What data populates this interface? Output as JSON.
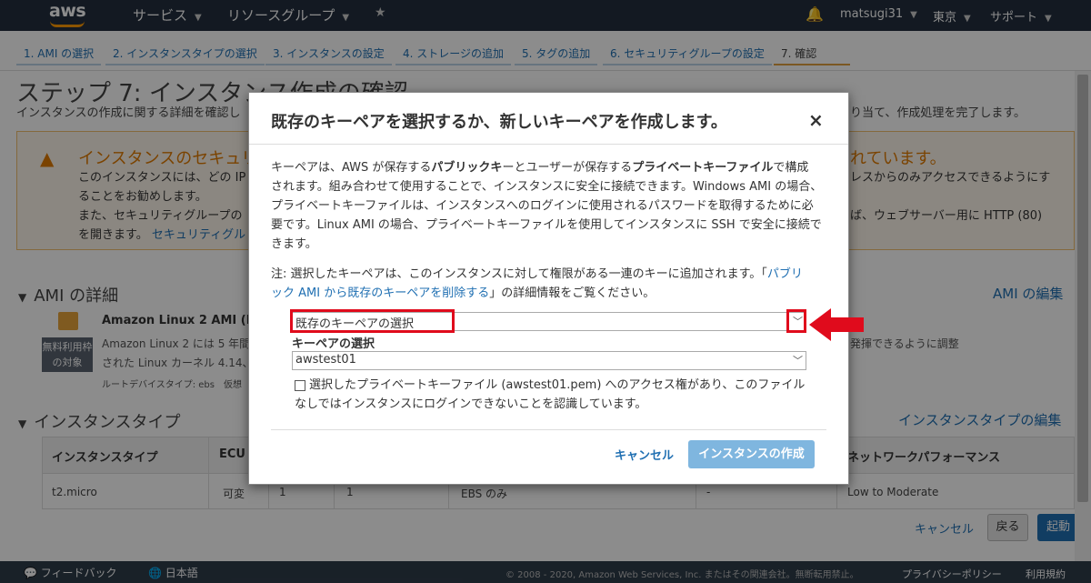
{
  "topnav": {
    "logo": "aws",
    "services": "サービス",
    "resource_groups": "リソースグループ",
    "user": "matsugi31",
    "region": "東京",
    "support": "サポート"
  },
  "tabs": [
    {
      "label": "1. AMI の選択"
    },
    {
      "label": "2. インスタンスタイプの選択"
    },
    {
      "label": "3. インスタンスの設定"
    },
    {
      "label": "4. ストレージの追加"
    },
    {
      "label": "5. タグの追加"
    },
    {
      "label": "6. セキュリティグループの設定"
    },
    {
      "label": "7. 確認"
    }
  ],
  "page": {
    "title": "ステップ 7: インスタンス作成の確認",
    "subtitle": "インスタンスの作成に関する詳細を確認し",
    "subtitle_right": "り当て、作成処理を完了します。",
    "warning_title": "インスタンスのセキュリ",
    "warning_title_right": "れています。",
    "warning_line1": "このインスタンスには、どの IP",
    "warning_line1_right": "レスからのみアクセスできるようにす",
    "warning_line2": "ることをお勧めします。",
    "warning_line3": "また、セキュリティグループの",
    "warning_line3_right": "ば、ウェブサーバー用に HTTP (80)",
    "warning_line4": "を開きます。",
    "warning_link": "セキュリティグル",
    "ami_section": "AMI の詳細",
    "ami_edit": "AMI の編集",
    "ami_name": "Amazon Linux 2 AMI (HV",
    "ami_badge_line1": "無料利用枠",
    "ami_badge_line2": "の対象",
    "ami_desc1": "Amazon Linux 2 には 5 年間の",
    "ami_desc1_right": "発揮できるように調整",
    "ami_desc2": "された Linux カーネル 4.14、",
    "ami_rootdev": "ルートデバイスタイプ: ebs　仮想",
    "instance_section": "インスタンスタイプ",
    "instance_edit": "インスタンスタイプの編集"
  },
  "table": {
    "headers": [
      "インスタンスタイプ",
      "ECU",
      "ネットワークパフォーマンス"
    ],
    "row": [
      "t2.micro",
      "可変",
      "1",
      "1",
      "EBS のみ",
      "-",
      "Low to Moderate"
    ]
  },
  "bottom_buttons": {
    "cancel": "キャンセル",
    "back": "戻る",
    "launch": "起動"
  },
  "footer": {
    "feedback": "フィードバック",
    "language": "日本語",
    "copyright": "© 2008 - 2020, Amazon Web Services, Inc. またはその関連会社。無断転用禁止。",
    "privacy": "プライバシーポリシー",
    "terms": "利用規約"
  },
  "modal": {
    "title": "既存のキーペアを選択するか、新しいキーペアを作成します。",
    "close": "×",
    "p1_l1_a": "キーペアは、AWS が保存する",
    "p1_l1_b": "パブリックキ",
    "p1_l1_c": "ーとユーザーが保存する",
    "p1_l1_d": "プライベートキーファイル",
    "p1_l1_e": "で構成",
    "p1_l2": "されます。組み合わせて使用することで、インスタンスに安全に接続できます。Windows AMI の場合、",
    "p1_l3": "プライベートキーファイルは、インスタンスへのログインに使用されるパスワードを取得するために必",
    "p1_l4": "要です。Linux AMI の場合、プライベートキーファイルを使用してインスタンスに SSH で安全に接続で",
    "p1_l5": "きます。",
    "note_l1_a": "注: 選択したキーペアは、このインスタンスに対して権限がある一連のキーに追加されます。「",
    "note_l1_link": "パブリ",
    "note_l2_link": "ック AMI から既存のキーペアを削除する",
    "note_l2_b": "」の詳細情報をご覧ください。",
    "select_option": "既存のキーペアの選択",
    "keypair_label": "キーペアの選択",
    "keypair_value": "awstest01",
    "ack_l1": "選択したプライベートキーファイル (awstest01.pem) へのアクセス権があり、このファイル",
    "ack_l2": "なしではインスタンスにログインできないことを認識しています。",
    "cancel": "キャンセル",
    "launch": "インスタンスの作成"
  },
  "colors": {
    "nav_bg": "#232f3e",
    "accent": "#1f6fb2",
    "warning": "#e07b00",
    "highlight_red": "#e00b1c"
  }
}
